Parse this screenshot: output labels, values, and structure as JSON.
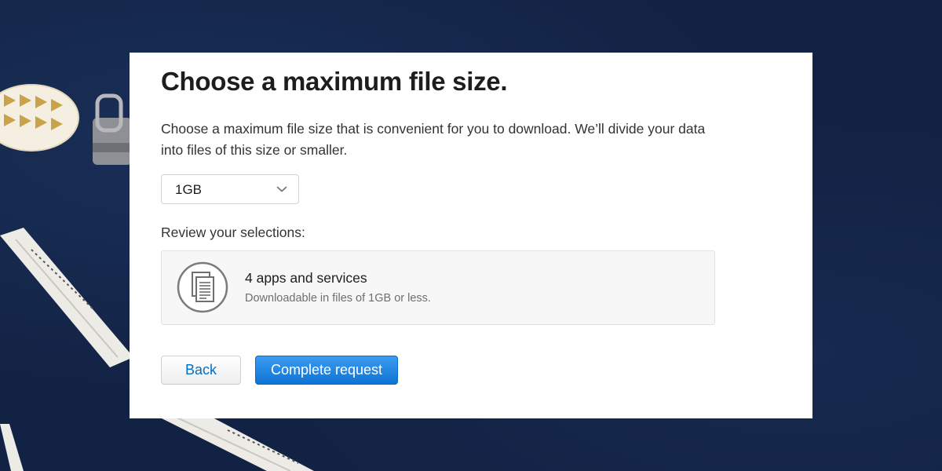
{
  "page": {
    "title": "Choose a maximum file size.",
    "description": "Choose a maximum file size that is convenient for you to download. We’ll divide your data into files of this size or smaller."
  },
  "size_select": {
    "selected": "1GB",
    "icon": "chevron-down-icon"
  },
  "review": {
    "label": "Review your selections:",
    "card": {
      "icon": "document-stack-icon",
      "title": "4 apps and services",
      "subtitle": "Downloadable in files of 1GB or less."
    }
  },
  "actions": {
    "back_label": "Back",
    "complete_label": "Complete request"
  },
  "colors": {
    "accent": "#0070c9",
    "primary_button": "#1a82e0",
    "background": "#132447"
  }
}
